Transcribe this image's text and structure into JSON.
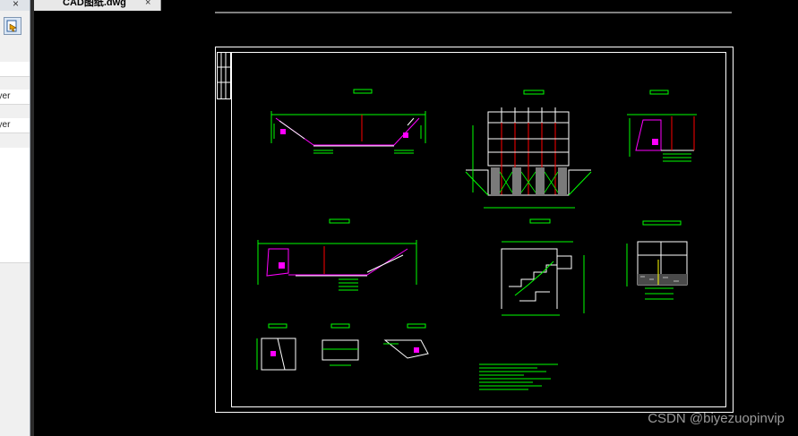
{
  "file_tab": {
    "title": "CAD图纸.dwg",
    "close_glyph": "×"
  },
  "left_panel": {
    "close_glyph": "×",
    "layer_rows": [
      "ayer",
      "ayer"
    ],
    "tool_icon": "layer-tool-icon"
  },
  "watermark": "CSDN @biyezuopinvip",
  "colors": {
    "background": "#000000",
    "frame": "#ffffff",
    "dimension": "#00ff00",
    "section": "#ff00ff",
    "accent": "#ff0000"
  }
}
